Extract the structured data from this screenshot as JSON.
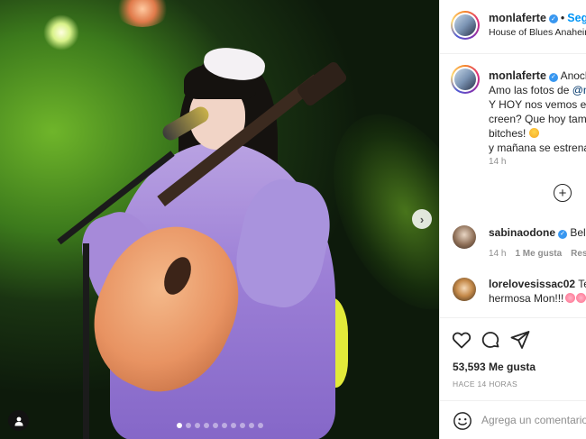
{
  "post": {
    "username": "monlaferte",
    "follow_label": "Seg",
    "location": "House of Blues Anaheim",
    "separator": "•",
    "carousel": {
      "slide_count": 10,
      "active_index": 0
    },
    "next_label": "›"
  },
  "caption": {
    "username": "monlaferte",
    "line1_after_name": "Anoch",
    "line2_prefix": "Amo las fotos de ",
    "line2_mention": "@m",
    "line3": "Y HOY nos vemos en",
    "line4": "creen? Que hoy tamb",
    "line5": "bitches!",
    "line6": "y mañana se estrena",
    "time": "14 h"
  },
  "comments": [
    {
      "username": "sabinaodone",
      "text": "Bella",
      "time": "14 h",
      "likes": "1 Me gusta",
      "reply": "Res",
      "verified": true
    },
    {
      "username": "lorelovesissac02",
      "text_line1": "Te",
      "text_line2": "hermosa Mon!!!",
      "verified": false
    }
  ],
  "actions": {
    "likes": "53,593 Me gusta",
    "ago": "HACE 14 HORAS"
  },
  "composer": {
    "placeholder": "Agrega un comentario"
  },
  "icons": {
    "tag": "user-tag-icon",
    "like": "heart-icon",
    "comment": "comment-icon",
    "share": "share-icon",
    "emoji": "smile-icon",
    "add": "plus-circle-icon",
    "verified": "verified-badge-icon"
  },
  "colors": {
    "link": "#0095f6",
    "verified": "#3897f0",
    "muted": "#8e8e8e",
    "text": "#262626"
  }
}
